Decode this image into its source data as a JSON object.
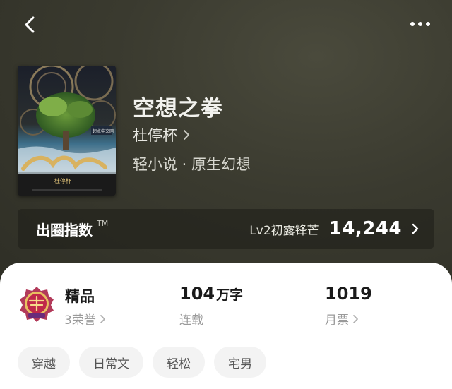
{
  "header": {
    "back_icon": "chevron-left-icon",
    "more_icon": "more-horizontal-icon"
  },
  "book": {
    "title": "空想之拳",
    "author": "杜停杯",
    "genre": "轻小说 · 原生幻想",
    "cover_author": "杜停杯"
  },
  "index": {
    "label": "出圈指数",
    "tm": "TM",
    "level": "Lv2初露锋芒",
    "value": "14,244"
  },
  "stats": {
    "honor_title": "精品",
    "honor_count": "3荣誉",
    "words": "104",
    "words_unit": "万字",
    "status": "连载",
    "tickets": "1019",
    "tickets_label": "月票"
  },
  "tags": [
    "穿越",
    "日常文",
    "轻松",
    "宅男"
  ],
  "colors": {
    "hero_bg": "#3a3a2e",
    "sheet_bg": "#ffffff",
    "tag_bg": "#f3f3f3",
    "badge_accent": "#b0304a"
  }
}
